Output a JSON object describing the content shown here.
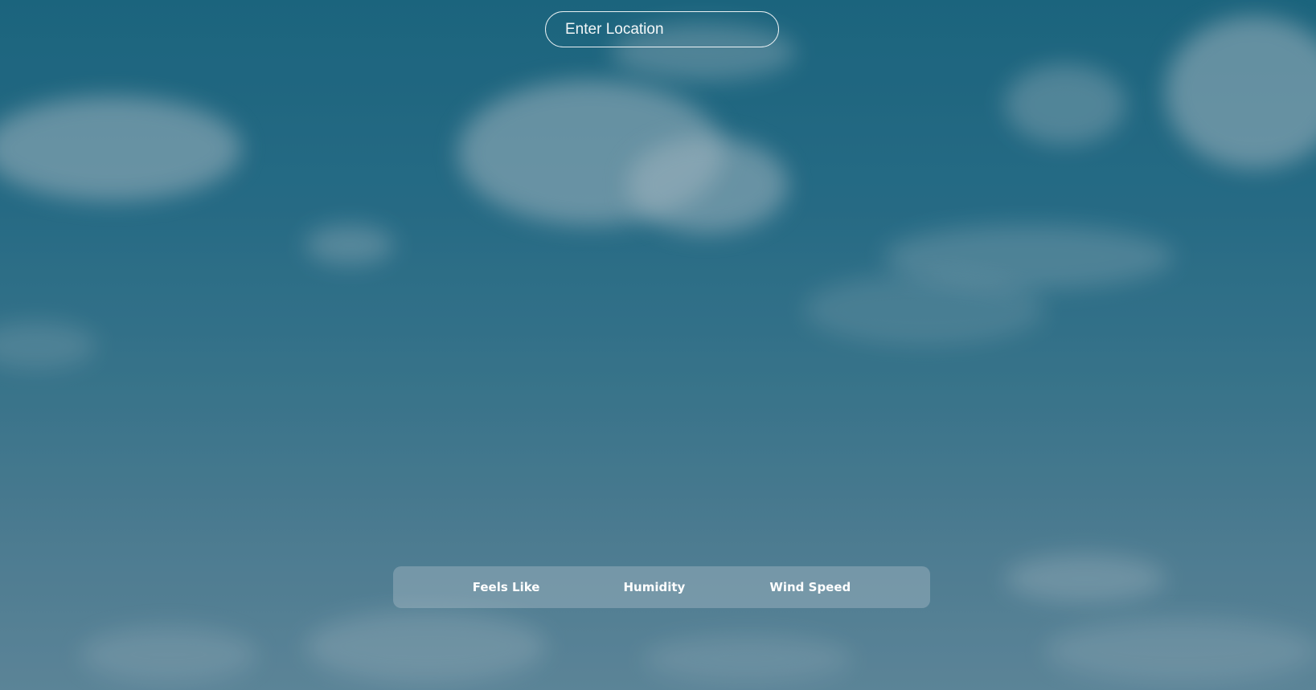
{
  "search": {
    "placeholder": "Enter Location",
    "value": ""
  },
  "details": {
    "feels_like_label": "Feels Like",
    "humidity_label": "Humidity",
    "wind_speed_label": "Wind Speed"
  },
  "colors": {
    "sky_top": "#1d6d88",
    "sky_bottom": "#6b94a8",
    "text": "#ffffff"
  }
}
